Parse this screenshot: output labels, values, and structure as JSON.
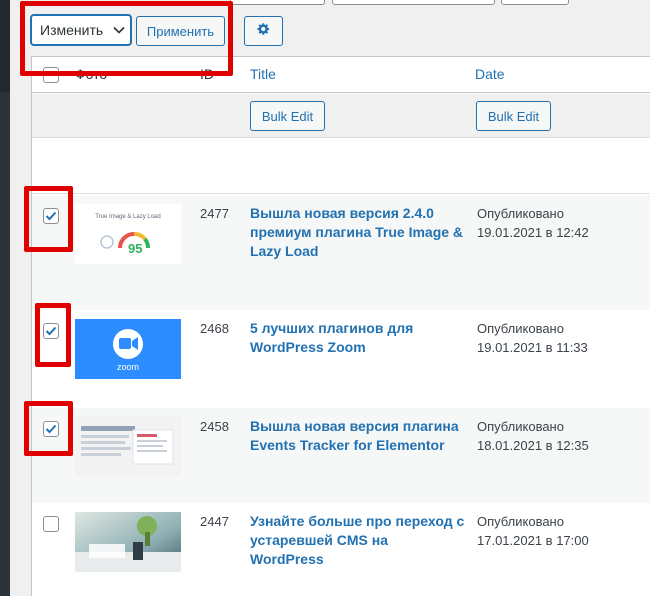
{
  "colors": {
    "accent": "#2271b1",
    "highlight": "#e00000",
    "admin_bar": "#23282d"
  },
  "toolbar": {
    "bulk_action_selected": "Изменить",
    "apply_label": "Применить",
    "settings_icon": "gear-icon"
  },
  "table": {
    "columns": {
      "photo": "Фото",
      "id": "ID",
      "title": "Title",
      "date": "Date"
    },
    "bulk_edit_label": "Bulk Edit",
    "rows": [
      {
        "id": "2477",
        "title": "Вышла новая версия 2.4.0 премиум плагина True Image & Lazy Load",
        "status": "Опубликовано",
        "date": "19.01.2021 в 12:42",
        "thumb_caption": "True Image & Lazy Load",
        "thumb_score": "95",
        "checked": true
      },
      {
        "id": "2468",
        "title": "5 лучших плагинов для WordPress Zoom",
        "status": "Опубликовано",
        "date": "19.01.2021 в 11:33",
        "thumb_caption": "zoom",
        "checked": true
      },
      {
        "id": "2458",
        "title": "Вышла новая версия плагина Events Tracker for Elementor",
        "status": "Опубликовано",
        "date": "18.01.2021 в 12:35",
        "checked": true
      },
      {
        "id": "2447",
        "title": "Узнайте больше про переход с устаревшей CMS на WordPress",
        "status": "Опубликовано",
        "date": "17.01.2021 в 17:00",
        "checked": false
      }
    ]
  }
}
